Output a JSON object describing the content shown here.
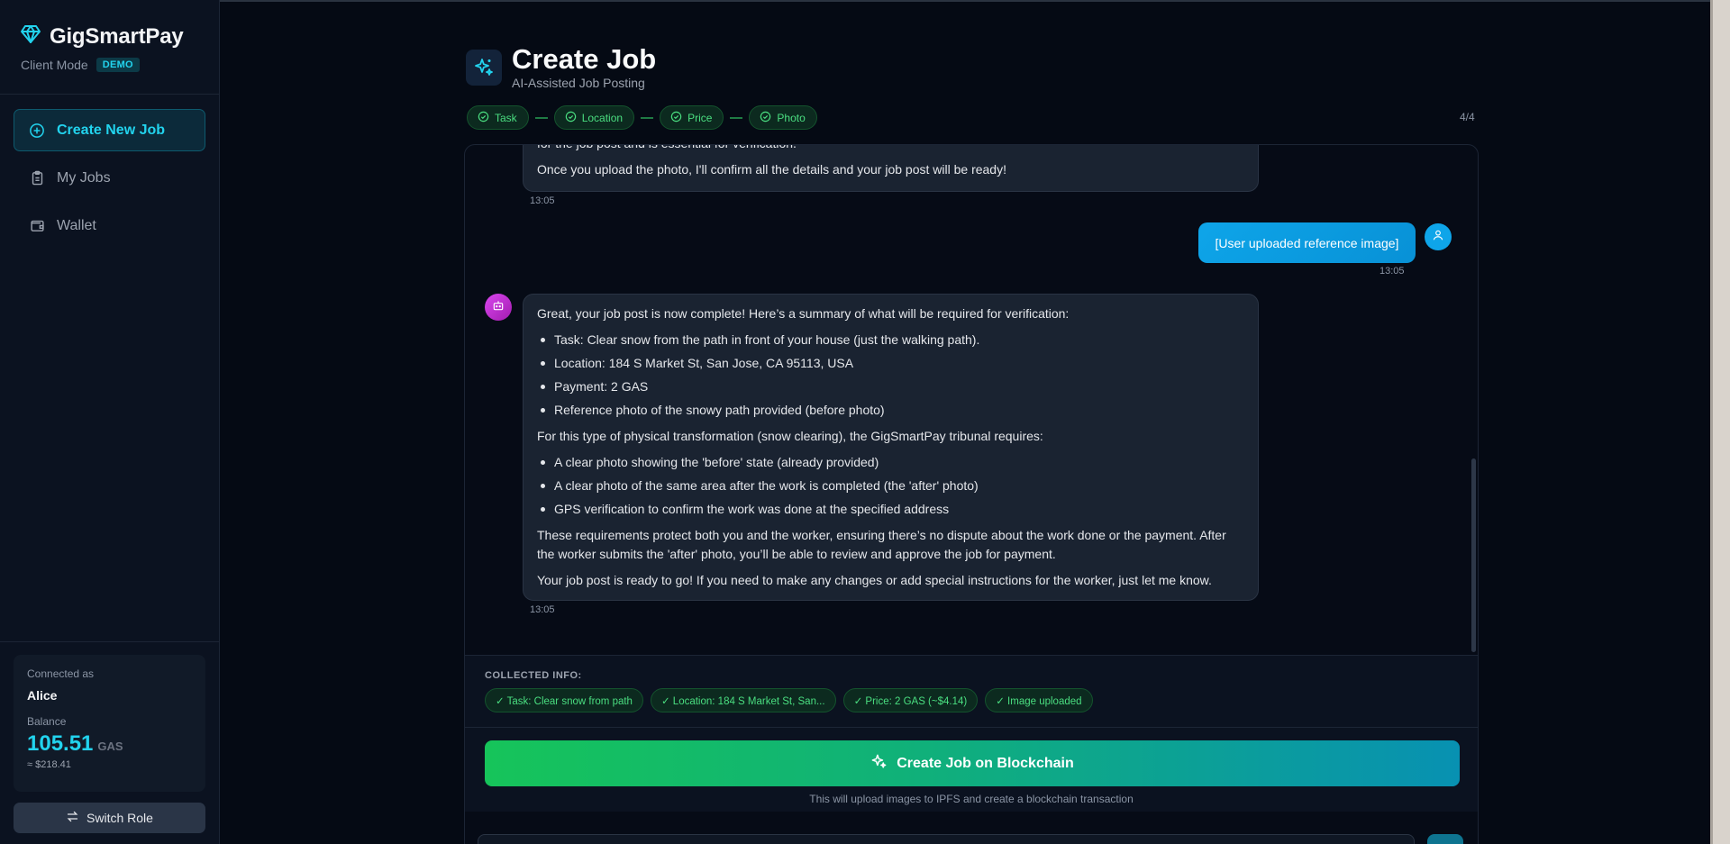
{
  "brand": {
    "name": "GigSmartPay",
    "mode": "Client Mode",
    "badge": "DEMO",
    "icon": "diamond-icon",
    "accent": "#22d3ee"
  },
  "nav": [
    {
      "label": "Create New Job",
      "icon": "plus-circle-icon",
      "active": true
    },
    {
      "label": "My Jobs",
      "icon": "clipboard-icon",
      "active": false
    },
    {
      "label": "Wallet",
      "icon": "wallet-icon",
      "active": false
    }
  ],
  "account": {
    "connected_label": "Connected as",
    "name": "Alice",
    "balance_label": "Balance",
    "balance": "105.51",
    "unit": "GAS",
    "usd": "≈ $218.41"
  },
  "switch_role": "Switch Role",
  "header": {
    "title": "Create Job",
    "subtitle": "AI-Assisted Job Posting",
    "icon": "sparkles-icon"
  },
  "steps": [
    {
      "label": "Task",
      "done": true
    },
    {
      "label": "Location",
      "done": true
    },
    {
      "label": "Price",
      "done": true
    },
    {
      "label": "Photo",
      "done": true
    }
  ],
  "step_count": "4/4",
  "messages": {
    "ai_prev": {
      "cut_line": "for the job post and is essential for verification.",
      "line": "Once you upload the photo, I'll confirm all the details and your job post will be ready!",
      "time": "13:05"
    },
    "user": {
      "text": "[User uploaded reference image]",
      "time": "13:05"
    },
    "ai_summary": {
      "intro": "Great, your job post is now complete! Here’s a summary of what will be required for verification:",
      "details": [
        "Task: Clear snow from the path in front of your house (just the walking path).",
        "Location: 184 S Market St, San Jose, CA 95113, USA",
        "Payment: 2 GAS",
        "Reference photo of the snowy path provided (before photo)"
      ],
      "tribunal_intro": "For this type of physical transformation (snow clearing), the GigSmartPay tribunal requires:",
      "requirements": [
        "A clear photo showing the 'before' state (already provided)",
        "A clear photo of the same area after the work is completed (the 'after' photo)",
        "GPS verification to confirm the work was done at the specified address"
      ],
      "protect": "These requirements protect both you and the worker, ensuring there’s no dispute about the work done or the payment. After the worker submits the 'after' photo, you’ll be able to review and approve the job for payment.",
      "ready": "Your job post is ready to go! If you need to make any changes or add special instructions for the worker, just let me know.",
      "time": "13:05"
    }
  },
  "collected": {
    "title": "COLLECTED INFO:",
    "tags": [
      "✓ Task: Clear snow from path",
      "✓ Location: 184 S Market St, San...",
      "✓ Price: 2 GAS (~$4.14)",
      "✓ Image uploaded"
    ]
  },
  "create_button": "Create Job on Blockchain",
  "create_note": "This will upload images to IPFS and create a blockchain transaction"
}
